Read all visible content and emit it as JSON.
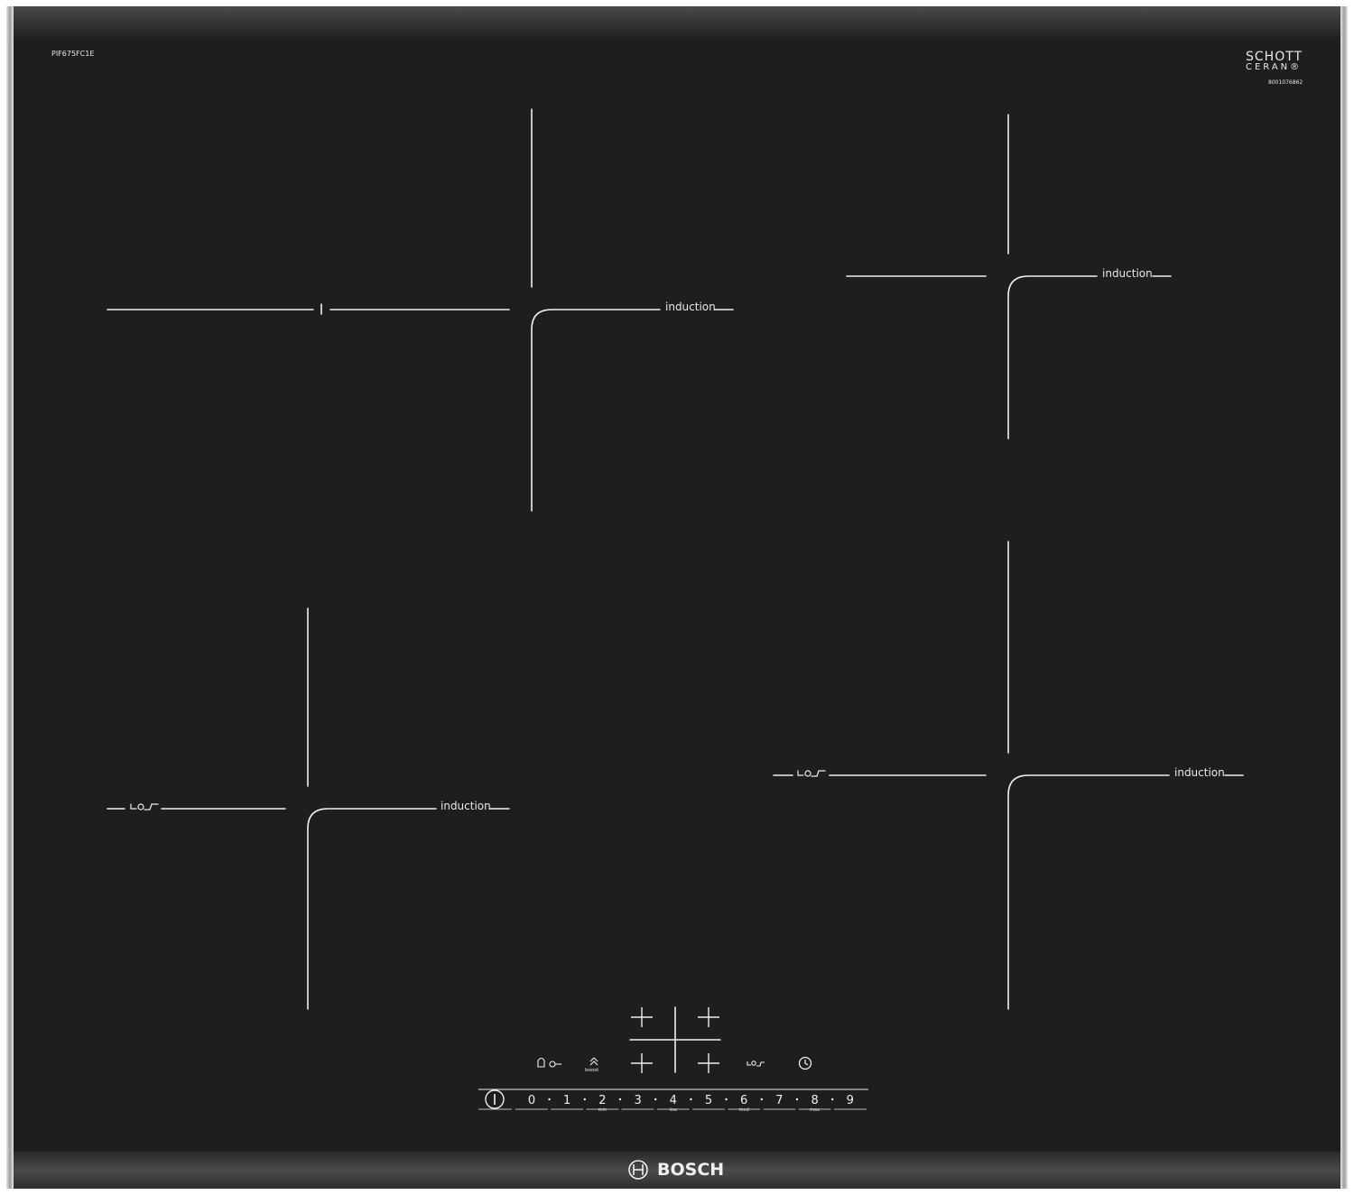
{
  "top_left": {
    "model_code": "PIF675FC1E"
  },
  "top_right": {
    "glass_brand_line1": "SCHOTT",
    "glass_brand_line2": "CERAN®",
    "serial": "8001076862"
  },
  "zones": {
    "top_left": {
      "label": "induction"
    },
    "top_right": {
      "label": "induction"
    },
    "bottom_left": {
      "label": "induction"
    },
    "bottom_right": {
      "label": "induction"
    }
  },
  "controls": {
    "levels": [
      "0",
      "1",
      "2",
      "3",
      "4",
      "5",
      "6",
      "7",
      "8",
      "9"
    ],
    "sublabels": {
      "2": "min",
      "4": "low",
      "6": "med",
      "8": "max"
    },
    "boost_label": "boost"
  },
  "footer": {
    "brand": "BOSCH"
  },
  "colors": {
    "glass": "#1e1e1e",
    "frame": "#c9c9c9",
    "markings": "#f0f0f0",
    "bottom_strip": "#3a3a3a"
  }
}
